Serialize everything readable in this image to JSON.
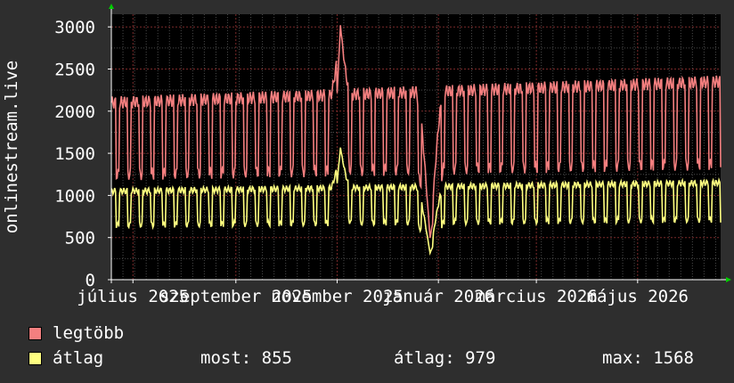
{
  "chart_data": {
    "type": "line",
    "ylabel": "onlinestream.live",
    "ylim": [
      0,
      3150
    ],
    "y_ticks": [
      0,
      500,
      1000,
      1500,
      2000,
      2500,
      3000
    ],
    "x_ticks": [
      {
        "label": "július 2025",
        "x": "2025-07-01"
      },
      {
        "label": "szeptember 2025",
        "x": "2025-09-01"
      },
      {
        "label": "november 2025",
        "x": "2025-11-01"
      },
      {
        "label": "január 2026",
        "x": "2026-01-01"
      },
      {
        "label": "március 2026",
        "x": "2026-03-01"
      },
      {
        "label": "május 2026",
        "x": "2026-05-01"
      }
    ],
    "x_range": [
      "2025-06-18",
      "2026-06-20"
    ],
    "grid": true,
    "series": [
      {
        "name": "legtöbb",
        "color": "#f47f7f",
        "weekday_high": 2100,
        "weekend_low": 1250,
        "trend_end_high": 2350,
        "outliers": [
          {
            "x": "2025-11-03",
            "y": 3020
          },
          {
            "x": "2025-12-27",
            "y": 800
          }
        ]
      },
      {
        "name": "átlag",
        "color": "#ffff80",
        "weekday_high": 1050,
        "weekend_low": 650,
        "trend_end_high": 1150,
        "outliers": [
          {
            "x": "2025-11-03",
            "y": 1568
          },
          {
            "x": "2025-12-27",
            "y": 510
          }
        ]
      }
    ]
  },
  "legend": {
    "max_label": "legtöbb",
    "avg_label": "átlag",
    "max_color": "#f47f7f",
    "avg_color": "#ffff80"
  },
  "stats": {
    "current": "most: 855",
    "average": "átlag: 979",
    "maximum": "max: 1568"
  }
}
